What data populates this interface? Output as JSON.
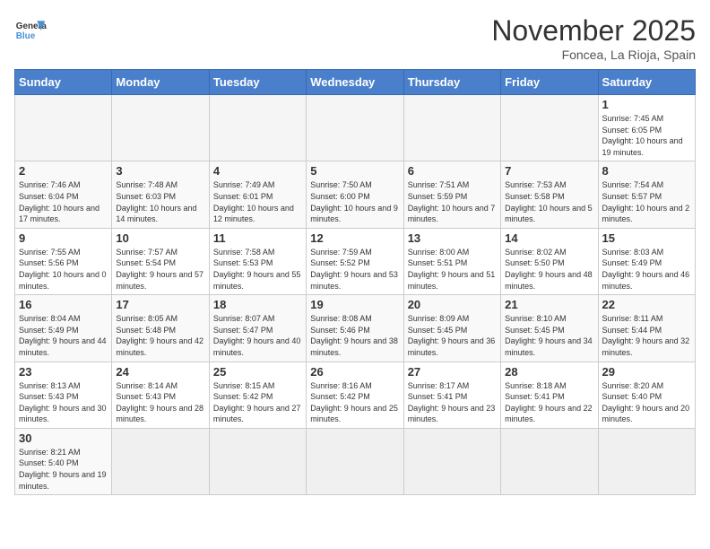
{
  "header": {
    "logo_general": "General",
    "logo_blue": "Blue",
    "month_year": "November 2025",
    "location": "Foncea, La Rioja, Spain"
  },
  "weekdays": [
    "Sunday",
    "Monday",
    "Tuesday",
    "Wednesday",
    "Thursday",
    "Friday",
    "Saturday"
  ],
  "weeks": [
    [
      {
        "day": "",
        "info": ""
      },
      {
        "day": "",
        "info": ""
      },
      {
        "day": "",
        "info": ""
      },
      {
        "day": "",
        "info": ""
      },
      {
        "day": "",
        "info": ""
      },
      {
        "day": "",
        "info": ""
      },
      {
        "day": "1",
        "info": "Sunrise: 7:45 AM\nSunset: 6:05 PM\nDaylight: 10 hours and 19 minutes."
      }
    ],
    [
      {
        "day": "2",
        "info": "Sunrise: 7:46 AM\nSunset: 6:04 PM\nDaylight: 10 hours and 17 minutes."
      },
      {
        "day": "3",
        "info": "Sunrise: 7:48 AM\nSunset: 6:03 PM\nDaylight: 10 hours and 14 minutes."
      },
      {
        "day": "4",
        "info": "Sunrise: 7:49 AM\nSunset: 6:01 PM\nDaylight: 10 hours and 12 minutes."
      },
      {
        "day": "5",
        "info": "Sunrise: 7:50 AM\nSunset: 6:00 PM\nDaylight: 10 hours and 9 minutes."
      },
      {
        "day": "6",
        "info": "Sunrise: 7:51 AM\nSunset: 5:59 PM\nDaylight: 10 hours and 7 minutes."
      },
      {
        "day": "7",
        "info": "Sunrise: 7:53 AM\nSunset: 5:58 PM\nDaylight: 10 hours and 5 minutes."
      },
      {
        "day": "8",
        "info": "Sunrise: 7:54 AM\nSunset: 5:57 PM\nDaylight: 10 hours and 2 minutes."
      }
    ],
    [
      {
        "day": "9",
        "info": "Sunrise: 7:55 AM\nSunset: 5:56 PM\nDaylight: 10 hours and 0 minutes."
      },
      {
        "day": "10",
        "info": "Sunrise: 7:57 AM\nSunset: 5:54 PM\nDaylight: 9 hours and 57 minutes."
      },
      {
        "day": "11",
        "info": "Sunrise: 7:58 AM\nSunset: 5:53 PM\nDaylight: 9 hours and 55 minutes."
      },
      {
        "day": "12",
        "info": "Sunrise: 7:59 AM\nSunset: 5:52 PM\nDaylight: 9 hours and 53 minutes."
      },
      {
        "day": "13",
        "info": "Sunrise: 8:00 AM\nSunset: 5:51 PM\nDaylight: 9 hours and 51 minutes."
      },
      {
        "day": "14",
        "info": "Sunrise: 8:02 AM\nSunset: 5:50 PM\nDaylight: 9 hours and 48 minutes."
      },
      {
        "day": "15",
        "info": "Sunrise: 8:03 AM\nSunset: 5:49 PM\nDaylight: 9 hours and 46 minutes."
      }
    ],
    [
      {
        "day": "16",
        "info": "Sunrise: 8:04 AM\nSunset: 5:49 PM\nDaylight: 9 hours and 44 minutes."
      },
      {
        "day": "17",
        "info": "Sunrise: 8:05 AM\nSunset: 5:48 PM\nDaylight: 9 hours and 42 minutes."
      },
      {
        "day": "18",
        "info": "Sunrise: 8:07 AM\nSunset: 5:47 PM\nDaylight: 9 hours and 40 minutes."
      },
      {
        "day": "19",
        "info": "Sunrise: 8:08 AM\nSunset: 5:46 PM\nDaylight: 9 hours and 38 minutes."
      },
      {
        "day": "20",
        "info": "Sunrise: 8:09 AM\nSunset: 5:45 PM\nDaylight: 9 hours and 36 minutes."
      },
      {
        "day": "21",
        "info": "Sunrise: 8:10 AM\nSunset: 5:45 PM\nDaylight: 9 hours and 34 minutes."
      },
      {
        "day": "22",
        "info": "Sunrise: 8:11 AM\nSunset: 5:44 PM\nDaylight: 9 hours and 32 minutes."
      }
    ],
    [
      {
        "day": "23",
        "info": "Sunrise: 8:13 AM\nSunset: 5:43 PM\nDaylight: 9 hours and 30 minutes."
      },
      {
        "day": "24",
        "info": "Sunrise: 8:14 AM\nSunset: 5:43 PM\nDaylight: 9 hours and 28 minutes."
      },
      {
        "day": "25",
        "info": "Sunrise: 8:15 AM\nSunset: 5:42 PM\nDaylight: 9 hours and 27 minutes."
      },
      {
        "day": "26",
        "info": "Sunrise: 8:16 AM\nSunset: 5:42 PM\nDaylight: 9 hours and 25 minutes."
      },
      {
        "day": "27",
        "info": "Sunrise: 8:17 AM\nSunset: 5:41 PM\nDaylight: 9 hours and 23 minutes."
      },
      {
        "day": "28",
        "info": "Sunrise: 8:18 AM\nSunset: 5:41 PM\nDaylight: 9 hours and 22 minutes."
      },
      {
        "day": "29",
        "info": "Sunrise: 8:20 AM\nSunset: 5:40 PM\nDaylight: 9 hours and 20 minutes."
      }
    ],
    [
      {
        "day": "30",
        "info": "Sunrise: 8:21 AM\nSunset: 5:40 PM\nDaylight: 9 hours and 19 minutes."
      },
      {
        "day": "",
        "info": ""
      },
      {
        "day": "",
        "info": ""
      },
      {
        "day": "",
        "info": ""
      },
      {
        "day": "",
        "info": ""
      },
      {
        "day": "",
        "info": ""
      },
      {
        "day": "",
        "info": ""
      }
    ]
  ]
}
